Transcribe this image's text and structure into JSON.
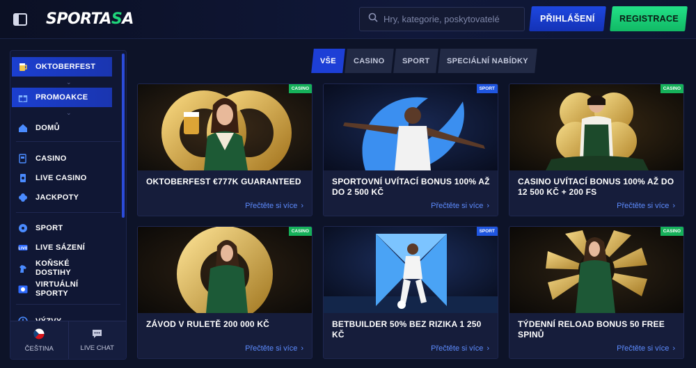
{
  "header": {
    "logo_main": "SPORTA",
    "logo_accent": "S",
    "logo_end": "A",
    "search_placeholder": "Hry, kategorie, poskytovatelé",
    "login_label": "PŘIHLÁŠENÍ",
    "register_label": "REGISTRACE"
  },
  "sidebar": {
    "items": [
      {
        "label": "OKTOBERFEST",
        "icon": "beer-icon"
      },
      {
        "label": "PROMOAKCE",
        "icon": "gift-icon"
      },
      {
        "label": "DOMŮ",
        "icon": "home-icon"
      },
      {
        "label": "CASINO",
        "icon": "slot-icon"
      },
      {
        "label": "LIVE CASINO",
        "icon": "card-icon"
      },
      {
        "label": "JACKPOTY",
        "icon": "clover-icon"
      },
      {
        "label": "SPORT",
        "icon": "ball-icon"
      },
      {
        "label": "LIVE SÁZENÍ",
        "icon": "live-icon"
      },
      {
        "label": "KOŇSKÉ DOSTIHY",
        "icon": "horse-icon"
      },
      {
        "label": "VIRTUÁLNÍ SPORTY",
        "icon": "virtual-icon"
      },
      {
        "label": "VÝZVY",
        "icon": "challenge-icon"
      }
    ],
    "footer": {
      "language_label": "ČEŠTINA",
      "chat_label": "LIVE CHAT"
    }
  },
  "tabs": [
    {
      "label": "VŠE",
      "active": true
    },
    {
      "label": "CASINO",
      "active": false
    },
    {
      "label": "SPORT",
      "active": false
    },
    {
      "label": "SPECIÁLNÍ NABÍDKY",
      "active": false
    }
  ],
  "cards": [
    {
      "badge": "CASINO",
      "title": "OKTOBERFEST €777K GUARANTEED",
      "more": "Přečtěte si více"
    },
    {
      "badge": "SPORT",
      "title": "SPORTOVNÍ UVÍTACÍ BONUS 100% AŽ DO 2 500 KČ",
      "more": "Přečtěte si více"
    },
    {
      "badge": "CASINO",
      "title": "CASINO UVÍTACÍ BONUS 100% AŽ DO 12 500 KČ + 200 FS",
      "more": "Přečtěte si více"
    },
    {
      "badge": "CASINO",
      "title": "ZÁVOD V RULETĚ 200 000 KČ",
      "more": "Přečtěte si více"
    },
    {
      "badge": "SPORT",
      "title": "BETBUILDER 50% BEZ RIZIKA 1 250 KČ",
      "more": "Přečtěte si více"
    },
    {
      "badge": "CASINO",
      "title": "TÝDENNÍ RELOAD BONUS 50 FREE SPINŮ",
      "more": "Přečtěte si více"
    }
  ],
  "colors": {
    "accent_blue": "#1d3fd6",
    "accent_green": "#1fd57a",
    "background": "#0d1328",
    "link": "#5d8cff"
  }
}
